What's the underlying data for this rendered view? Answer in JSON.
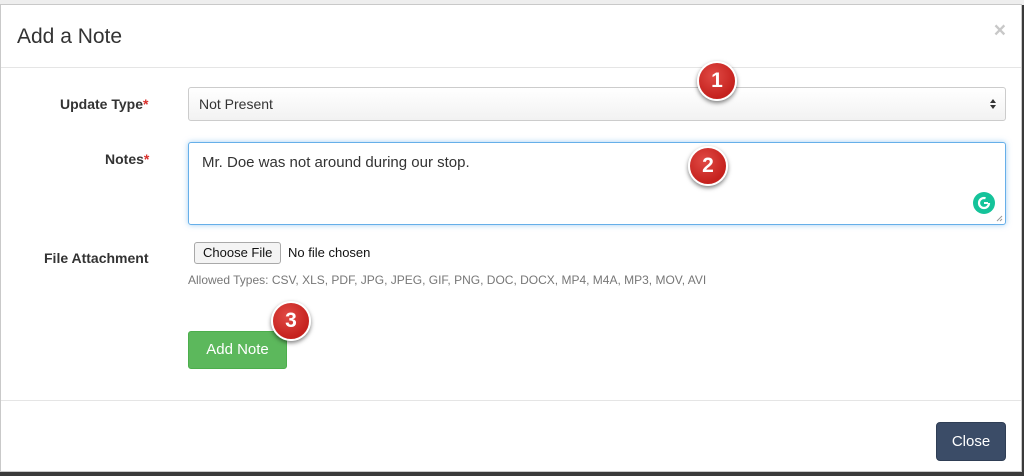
{
  "modal": {
    "title": "Add a Note",
    "close_glyph": "×"
  },
  "form": {
    "update_type": {
      "label": "Update Type",
      "required_mark": "*",
      "selected": "Not Present"
    },
    "notes": {
      "label": "Notes",
      "required_mark": "*",
      "value": "Mr. Doe was not around during our stop."
    },
    "attachment": {
      "label": "File Attachment",
      "button_label": "Choose File",
      "status": "No file chosen",
      "allowed_types": "Allowed Types: CSV, XLS, PDF, JPG, JPEG, GIF, PNG, DOC, DOCX, MP4, M4A, MP3, MOV, AVI"
    },
    "submit_label": "Add Note"
  },
  "footer": {
    "close_label": "Close"
  },
  "callouts": [
    "1",
    "2",
    "3"
  ],
  "colors": {
    "add_button": "#5cb85c",
    "close_button": "#3b4c67",
    "callout": "#c5211d",
    "required": "#d9302c",
    "focus_border": "#66afe9",
    "grammarly": "#15c39a"
  }
}
